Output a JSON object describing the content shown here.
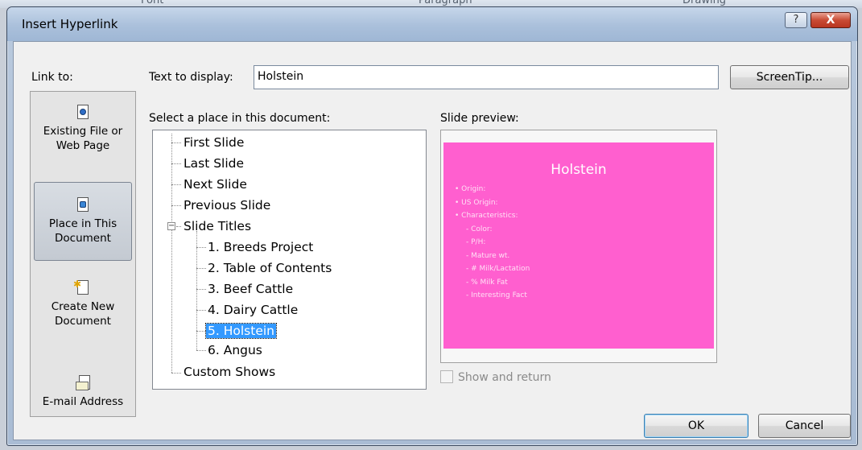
{
  "background_ribbon": {
    "labels": [
      "Font",
      "Paragraph",
      "Drawing"
    ]
  },
  "dialog": {
    "title": "Insert Hyperlink",
    "help_label": "?",
    "close_label": "X"
  },
  "link_to": {
    "label": "Link to:",
    "items": [
      {
        "line1": "Existing File or",
        "line2": "Web Page",
        "icon": "existing-file-icon"
      },
      {
        "line1": "Place in This",
        "line2": "Document",
        "icon": "place-in-document-icon",
        "selected": true
      },
      {
        "line1": "Create New",
        "line2": "Document",
        "icon": "create-new-document-icon"
      },
      {
        "line1": "E-mail Address",
        "line2": "",
        "icon": "email-address-icon"
      }
    ]
  },
  "text_to_display": {
    "label": "Text to display:",
    "value": "Holstein"
  },
  "screentip_button": "ScreenTip...",
  "place_section": {
    "label": "Select a place in this document:",
    "items": [
      {
        "text": "First Slide",
        "level": 0
      },
      {
        "text": "Last Slide",
        "level": 0
      },
      {
        "text": "Next Slide",
        "level": 0
      },
      {
        "text": "Previous Slide",
        "level": 0
      },
      {
        "text": "Slide Titles",
        "level": 0,
        "expanded": true
      },
      {
        "text": "1. Breeds Project",
        "level": 1
      },
      {
        "text": "2. Table of Contents",
        "level": 1
      },
      {
        "text": "3. Beef Cattle",
        "level": 1
      },
      {
        "text": "4. Dairy Cattle",
        "level": 1
      },
      {
        "text": "5. Holstein",
        "level": 1,
        "selected": true
      },
      {
        "text": "6. Angus",
        "level": 1
      },
      {
        "text": "Custom Shows",
        "level": 0
      }
    ]
  },
  "preview": {
    "label": "Slide preview:",
    "slide_title": "Holstein",
    "slide_color": "#ff5fcf",
    "bullets": [
      {
        "text": "Origin:",
        "sub": false
      },
      {
        "text": "US Origin:",
        "sub": false
      },
      {
        "text": "Characteristics:",
        "sub": false
      },
      {
        "text": "Color:",
        "sub": true
      },
      {
        "text": "P/H:",
        "sub": true
      },
      {
        "text": "Mature wt.",
        "sub": true
      },
      {
        "text": "# Milk/Lactation",
        "sub": true
      },
      {
        "text": "% Milk Fat",
        "sub": true
      },
      {
        "text": "Interesting Fact",
        "sub": true
      }
    ]
  },
  "show_and_return": {
    "label": "Show and return",
    "checked": false,
    "enabled": false
  },
  "buttons": {
    "ok": "OK",
    "cancel": "Cancel"
  }
}
